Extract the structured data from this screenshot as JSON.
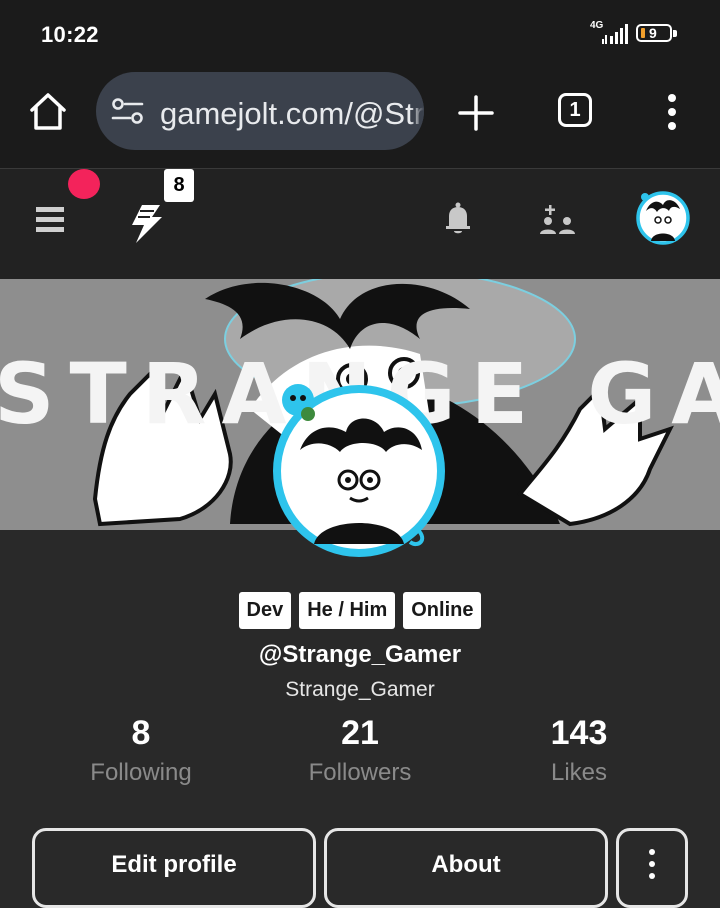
{
  "status_bar": {
    "time": "10:22",
    "network": "4G",
    "battery": "9"
  },
  "browser": {
    "url": "gamejolt.com/@Strange_Gamer",
    "tab_count": "1"
  },
  "nav": {
    "bolt_badge": "8"
  },
  "banner": {
    "text": "STRANGE GAMER"
  },
  "profile": {
    "tags": [
      "Dev",
      "He / Him",
      "Online"
    ],
    "handle": "@Strange_Gamer",
    "display_name": "Strange_Gamer",
    "stats": {
      "following": {
        "value": "8",
        "label": "Following"
      },
      "followers": {
        "value": "21",
        "label": "Followers"
      },
      "likes": {
        "value": "143",
        "label": "Likes"
      }
    },
    "buttons": {
      "edit": "Edit profile",
      "about": "About"
    }
  },
  "colors": {
    "notification_dot": "#f3235b",
    "avatar_ring": "#2ec4ec",
    "background": "#292929"
  }
}
